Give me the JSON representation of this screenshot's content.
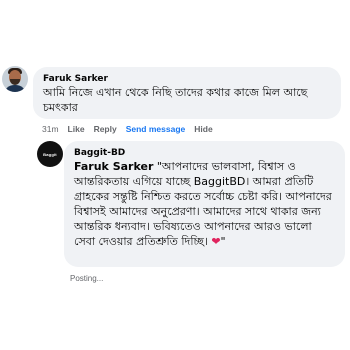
{
  "comment1": {
    "author": "Faruk Sarker",
    "text": "আমি নিজে এখান থেকে নিছি তাদের কথার কাজে মিল আছে চমৎকার",
    "actions": {
      "time": "31m",
      "like": "Like",
      "reply": "Reply",
      "send": "Send message",
      "hide": "Hide"
    }
  },
  "comment2": {
    "author": "Baggit-BD",
    "mention": "Faruk Sarker",
    "text": " \"আপনাদের ভালবাসা, বিশ্বাস ও আন্তরিকতায় এগিয়ে যাচ্ছে BaggitBD। আমরা প্রতিটি গ্রাহকের সন্তুষ্টি নিশ্চিত করতে সর্বোচ্চ চেষ্টা করি। আপনাদের বিশ্বাসই আমাদের অনুপ্রেরণা। আমাদের সাথে থাকার জন্য আন্তরিক ধন্যবাদ। ভবিষ্যতেও আপনাদের আরও ভালো সেবা দেওয়ার প্রতিশ্রুতি দিচ্ছি।",
    "heart": "❤",
    "closing": "\"",
    "logo_text": "Baggit",
    "status": "Posting..."
  },
  "colors": {
    "bubble": "#f0f2f5",
    "link": "#1877f2",
    "muted": "#65676b",
    "heart": "#e0245e"
  }
}
